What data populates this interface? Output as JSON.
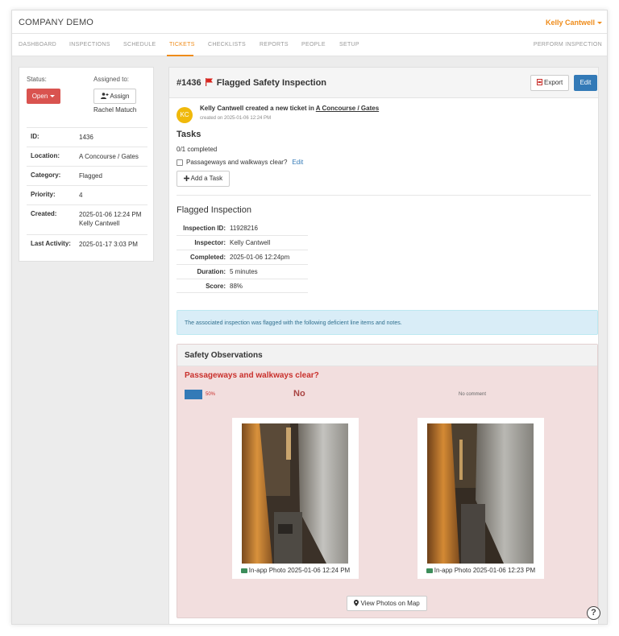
{
  "header": {
    "brand": "COMPANY DEMO",
    "user": "Kelly Cantwell"
  },
  "nav": {
    "items": [
      {
        "label": "DASHBOARD",
        "active": false
      },
      {
        "label": "INSPECTIONS",
        "active": false
      },
      {
        "label": "SCHEDULE",
        "active": false
      },
      {
        "label": "TICKETS",
        "active": true
      },
      {
        "label": "CHECKLISTS",
        "active": false
      },
      {
        "label": "REPORTS",
        "active": false
      },
      {
        "label": "PEOPLE",
        "active": false
      },
      {
        "label": "SETUP",
        "active": false
      }
    ],
    "right": "PERFORM INSPECTION"
  },
  "sidebar": {
    "status_label": "Status:",
    "status_value": "Open",
    "assigned_label": "Assigned to:",
    "assign_button": "Assign",
    "assignee": "Rachel Matuch",
    "details": {
      "id_label": "ID:",
      "id_value": "1436",
      "location_label": "Location:",
      "location_value": "A Concourse / Gates",
      "category_label": "Category:",
      "category_value": "Flagged",
      "priority_label": "Priority:",
      "priority_value": "4",
      "created_label": "Created:",
      "created_value": "2025-01-06 12:24 PM",
      "created_by": "Kelly Cantwell",
      "activity_label": "Last Activity:",
      "activity_value": "2025-01-17 3:03 PM"
    }
  },
  "ticket": {
    "number": "#1436",
    "title": "Flagged Safety Inspection",
    "export_button": "Export",
    "edit_button": "Edit",
    "avatar_initials": "KC",
    "activity_text": "Kelly Cantwell created a new ticket in",
    "activity_link": "A Concourse / Gates",
    "activity_sub": "created on 2025-01-06 12:24 PM"
  },
  "tasks": {
    "heading": "Tasks",
    "count": "0/1 completed",
    "item": "Passageways and walkways clear?",
    "item_edit": "Edit",
    "add_button": "Add a Task"
  },
  "inspection": {
    "heading": "Flagged Inspection",
    "id_label": "Inspection ID:",
    "id_value": "11928216",
    "inspector_label": "Inspector:",
    "inspector_value": "Kelly Cantwell",
    "completed_label": "Completed:",
    "completed_value": "2025-01-06 12:24pm",
    "duration_label": "Duration:",
    "duration_value": "5 minutes",
    "score_label": "Score:",
    "score_value": "88%"
  },
  "alert": "The associated inspection was flagged with the following deficient line items and notes.",
  "observations": {
    "heading": "Safety Observations",
    "question": "Passageways and walkways clear?",
    "percent": "50%",
    "answer": "No",
    "comment": "No comment",
    "photos": [
      {
        "caption": "In-app Photo 2025-01-06 12:24 PM"
      },
      {
        "caption": "In-app Photo 2025-01-06 12:23 PM"
      }
    ],
    "map_button": "View Photos on Map"
  },
  "help_icon": "?",
  "colors": {
    "accent": "#ef8c1a",
    "danger": "#d9534f",
    "primary": "#337ab7",
    "obs_bg": "#f2dede",
    "alert_bg": "#d9edf7"
  }
}
